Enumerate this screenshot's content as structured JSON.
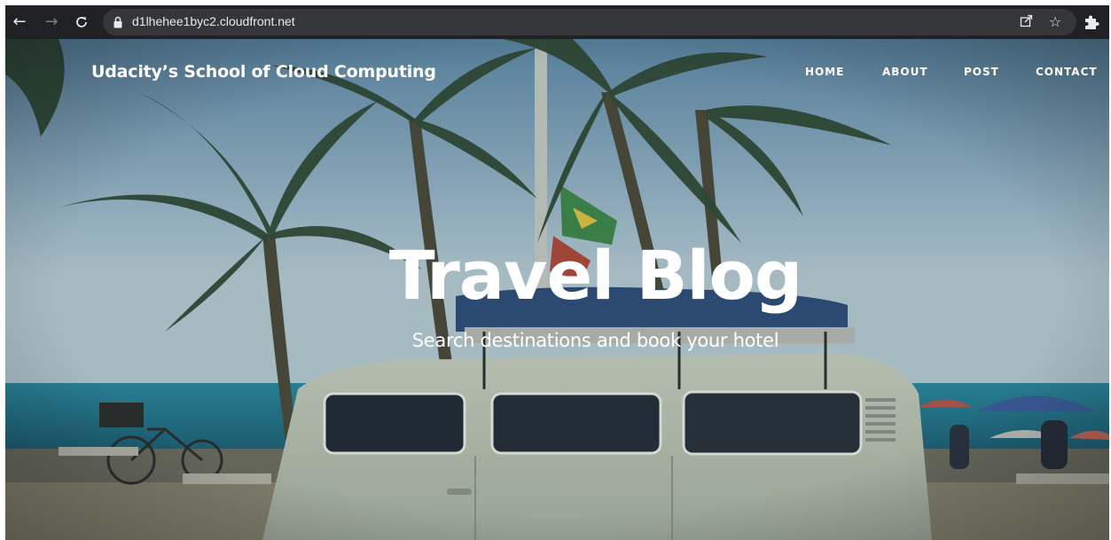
{
  "browser": {
    "url": "d1lhehee1byc2.cloudfront.net",
    "icons": {
      "back": "back-arrow-icon",
      "forward": "forward-arrow-icon",
      "reload": "reload-icon",
      "lock": "lock-icon",
      "share": "share-icon",
      "bookmark": "star-icon",
      "extensions": "puzzle-icon"
    }
  },
  "site": {
    "brand": "Udacity’s School of Cloud Computing",
    "nav": [
      "HOME",
      "ABOUT",
      "POST",
      "CONTACT"
    ]
  },
  "hero": {
    "title": "Travel Blog",
    "subtitle": "Search destinations and book your hotel"
  },
  "colors": {
    "toolbar_bg": "#202124",
    "omnibox_bg": "#35363a",
    "text_white": "#ffffff",
    "sea": "#1f6f86"
  }
}
